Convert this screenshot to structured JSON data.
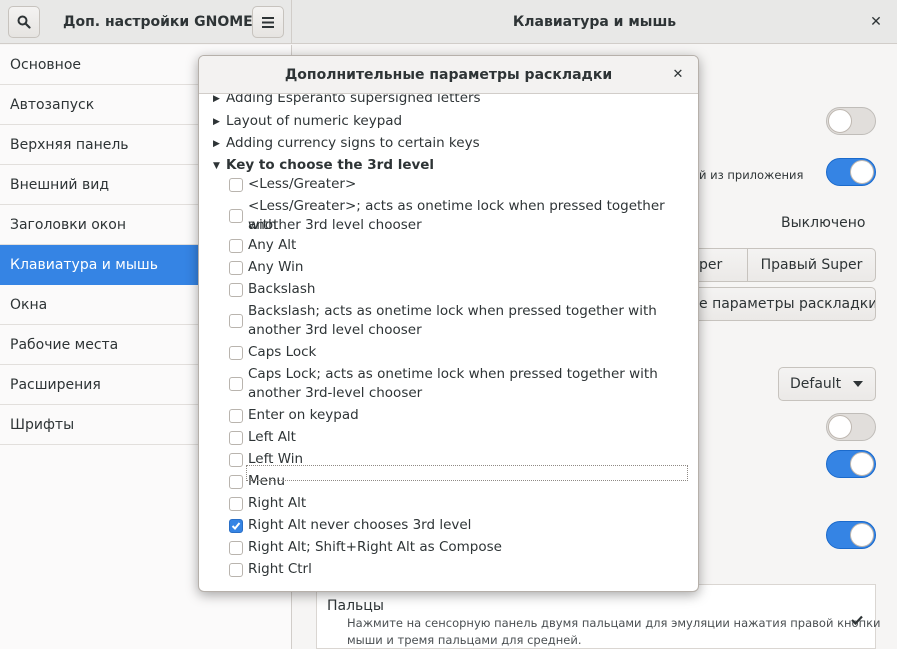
{
  "header": {
    "app_title": "Доп. настройки GNOME",
    "page_title": "Клавиатура и мышь"
  },
  "sidebar": {
    "items": [
      {
        "label": "Основное"
      },
      {
        "label": "Автозапуск"
      },
      {
        "label": "Верхняя панель"
      },
      {
        "label": "Внешний вид"
      },
      {
        "label": "Заголовки окон"
      },
      {
        "label": "Клавиатура и мышь"
      },
      {
        "label": "Окна"
      },
      {
        "label": "Рабочие места"
      },
      {
        "label": "Расширения"
      },
      {
        "label": "Шрифты"
      }
    ],
    "selected_index": 5
  },
  "background": {
    "app_hint_text": "й из приложения",
    "state_text": "Выключено",
    "super_left_label": "per",
    "super_right_label": "Правый Super",
    "layout_button_label": "е параметры раскладки",
    "dropdown_value": "Default",
    "fingers_title": "Пальцы",
    "fingers_desc_1": "Нажмите на сенсорную панель двумя пальцами для эмуляции нажатия правой кнопки",
    "fingers_desc_2": "мыши и тремя пальцами для средней.",
    "switches": [
      false,
      true,
      false,
      true,
      true
    ]
  },
  "dialog": {
    "title": "Дополнительные параметры раскладки",
    "partial_top_label": "Adding Esperanto supersigned letters",
    "collapsed_groups": [
      {
        "label": "Layout of numeric keypad"
      },
      {
        "label": "Adding currency signs to certain keys"
      }
    ],
    "expanded_group": {
      "label": "Key to choose the 3rd level",
      "options": [
        {
          "line1": "<Less/Greater>",
          "line2": "",
          "checked": false
        },
        {
          "line1": "<Less/Greater>; acts as onetime lock when pressed together with",
          "line2": "another 3rd level chooser",
          "checked": false
        },
        {
          "line1": "Any Alt",
          "line2": "",
          "checked": false
        },
        {
          "line1": "Any Win",
          "line2": "",
          "checked": false
        },
        {
          "line1": "Backslash",
          "line2": "",
          "checked": false
        },
        {
          "line1": "Backslash; acts as onetime lock when pressed together with",
          "line2": "another 3rd level chooser",
          "checked": false
        },
        {
          "line1": "Caps Lock",
          "line2": "",
          "checked": false
        },
        {
          "line1": "Caps Lock; acts as onetime lock when pressed together with",
          "line2": "another 3rd-level chooser",
          "checked": false
        },
        {
          "line1": "Enter on keypad",
          "line2": "",
          "checked": false
        },
        {
          "line1": "Left Alt",
          "line2": "",
          "checked": false
        },
        {
          "line1": "Left Win",
          "line2": "",
          "checked": false
        },
        {
          "line1": "Menu",
          "line2": "",
          "checked": false
        },
        {
          "line1": "Right Alt",
          "line2": "",
          "checked": false
        },
        {
          "line1": "Right Alt never chooses 3rd level",
          "line2": "",
          "checked": true
        },
        {
          "line1": "Right Alt; Shift+Right Alt as Compose",
          "line2": "",
          "checked": false
        },
        {
          "line1": "Right Ctrl",
          "line2": "",
          "checked": false
        }
      ]
    }
  },
  "colors": {
    "accent": "#3584e4",
    "sidebar_bg": "#fbfafa",
    "window_bg": "#f6f5f4",
    "headerbar_bg": "#e8e8e7"
  },
  "icons": {
    "search": "search-icon",
    "menu": "hamburger-menu-icon",
    "close": "close-icon",
    "expander": "triangle-expander-icon",
    "dropdown": "chevron-down-icon",
    "check": "checkmark-icon"
  }
}
